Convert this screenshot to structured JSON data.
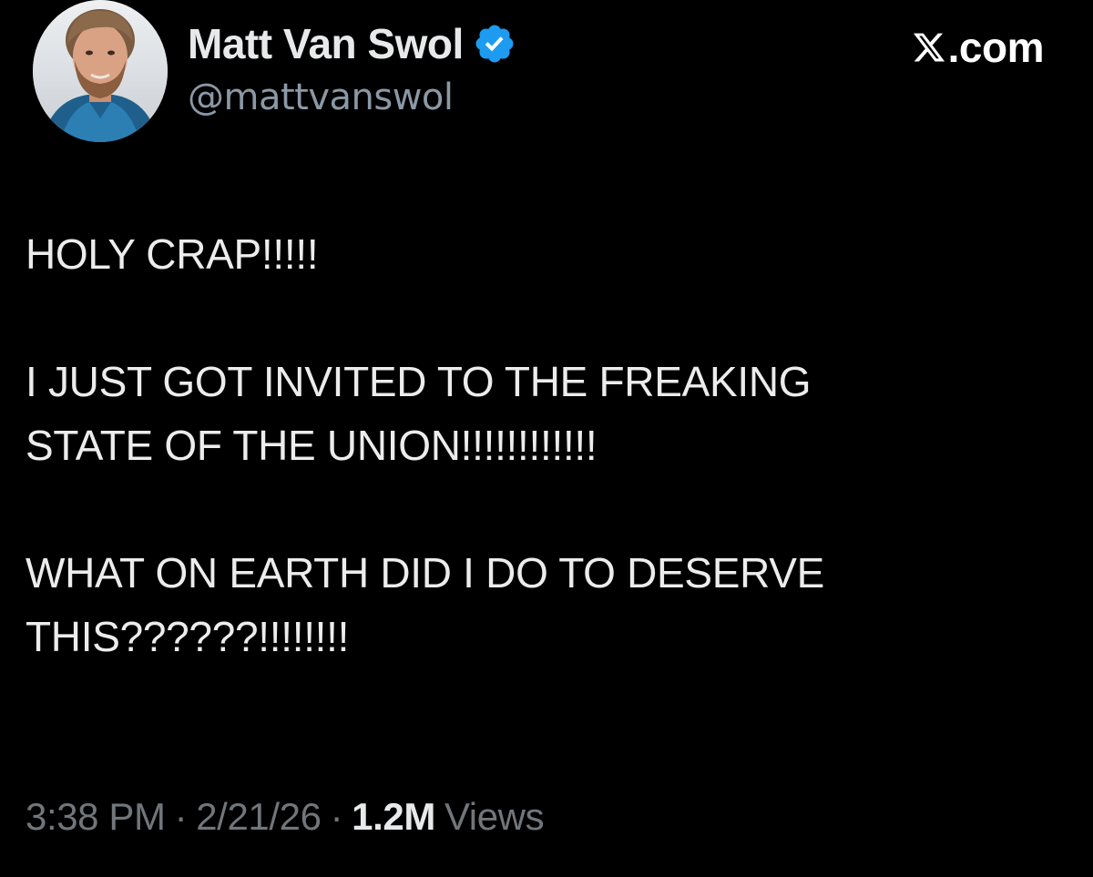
{
  "author": {
    "display_name": "Matt Van Swol",
    "handle": "@mattvanswol",
    "verified": true,
    "verified_color": "#1d9bf0",
    "avatar_icon": "profile-photo"
  },
  "site": {
    "logo_icon": "x-logo-icon",
    "label": ".com"
  },
  "post": {
    "paragraphs": [
      "HOLY CRAP!!!!!",
      "I JUST GOT INVITED TO THE FREAKING",
      "STATE OF THE UNION!!!!!!!!!!!!",
      "WHAT ON EARTH DID I DO TO DESERVE",
      "THIS??????!!!!!!!!"
    ]
  },
  "meta": {
    "time": "3:38 PM",
    "separator": "·",
    "date": "2/21/26",
    "views_count": "1.2M",
    "views_label": "Views"
  },
  "colors": {
    "background": "#000000",
    "primary_text": "#e7e9ea",
    "secondary_text": "#71767b",
    "handle_text": "#8b98a5"
  }
}
